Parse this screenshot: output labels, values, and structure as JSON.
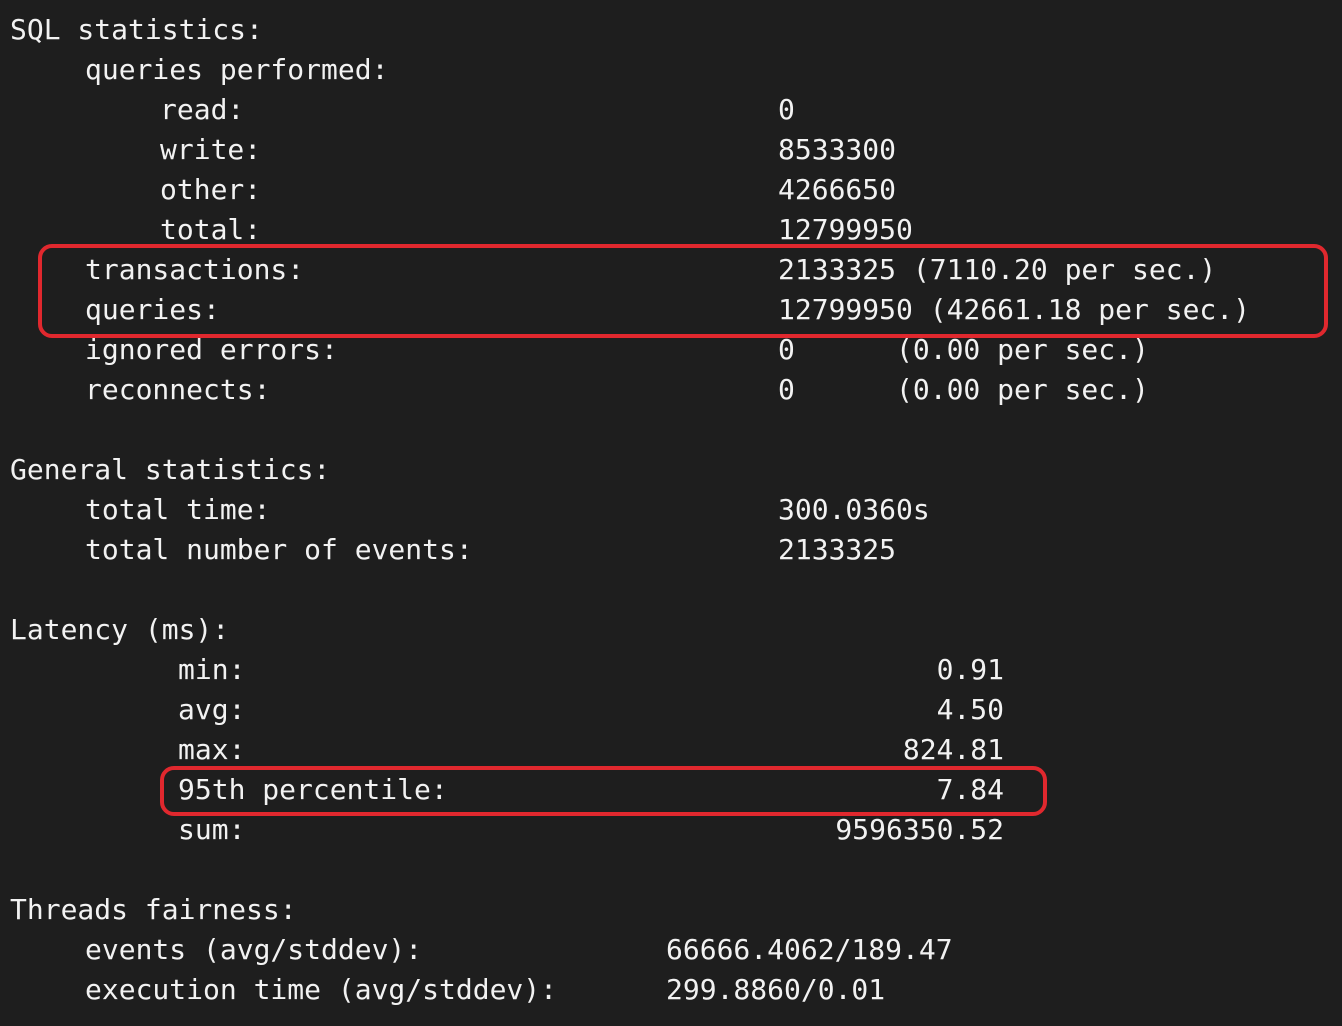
{
  "sql": {
    "header": "SQL statistics:",
    "queries_performed_label": "queries performed:",
    "read_label": "read:",
    "read_value": "0",
    "write_label": "write:",
    "write_value": "8533300",
    "other_label": "other:",
    "other_value": "4266650",
    "total_label": "total:",
    "total_value": "12799950",
    "transactions_label": "transactions:",
    "transactions_value": "2133325 (7110.20 per sec.)",
    "queries_label": "queries:",
    "queries_value": "12799950 (42661.18 per sec.)",
    "ignored_errors_label": "ignored errors:",
    "ignored_errors_value": "0      (0.00 per sec.)",
    "reconnects_label": "reconnects:",
    "reconnects_value": "0      (0.00 per sec.)"
  },
  "general": {
    "header": "General statistics:",
    "total_time_label": "total time:",
    "total_time_value": "300.0360s",
    "total_events_label": "total number of events:",
    "total_events_value": "2133325"
  },
  "latency": {
    "header": "Latency (ms):",
    "min_label": "min:",
    "min_value": "0.91",
    "avg_label": "avg:",
    "avg_value": "4.50",
    "max_label": "max:",
    "max_value": "824.81",
    "p95_label": "95th percentile:",
    "p95_value": "7.84",
    "sum_label": "sum:",
    "sum_value": "9596350.52"
  },
  "threads": {
    "header": "Threads fairness:",
    "events_label": "events (avg/stddev):",
    "events_value": "66666.4062/189.47",
    "exec_time_label": "execution time (avg/stddev):",
    "exec_time_value": "299.8860/0.01"
  },
  "highlight_color": "#e0282e"
}
